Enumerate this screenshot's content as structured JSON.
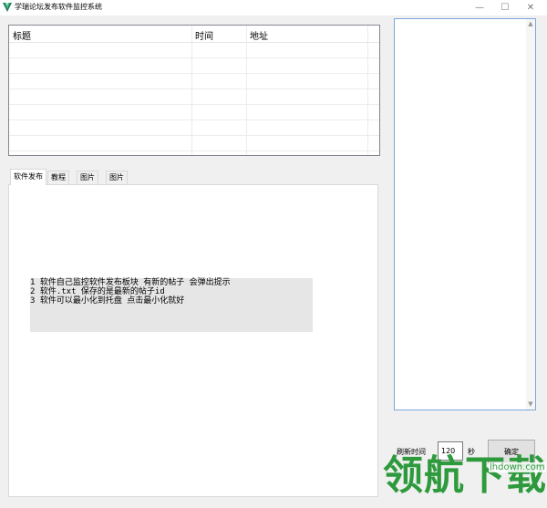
{
  "window": {
    "title": "学瑞论坛发布软件监控系统",
    "icon": "v-logo-icon",
    "minimize": "—",
    "maximize": "☐",
    "close": "✕"
  },
  "table": {
    "columns": [
      "标题",
      "时间",
      "地址"
    ],
    "rows": []
  },
  "tabs": [
    "软件发布",
    "教程",
    "图片",
    "图片"
  ],
  "active_tab": "软件发布",
  "notes": [
    "1 软件自己监控软件发布板块 有新的帖子 会弹出提示",
    "2 软件.txt 保存的是最新的帖子id",
    "3 软件可以最小化到托盘 点击最小化就好"
  ],
  "refresh": {
    "label": "刷新时间",
    "value": "120",
    "unit": "秒",
    "button": "确定"
  },
  "watermark": {
    "text": "领航下载",
    "url": "lhdown.com",
    "color": "#2e9a3d"
  },
  "colors": {
    "listbox_border": "#7aa7d8"
  }
}
